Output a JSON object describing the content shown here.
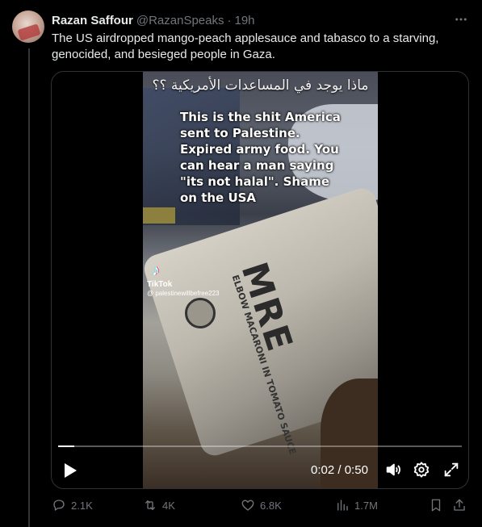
{
  "tweet": {
    "author_name": "Razan Saffour",
    "author_handle": "@RazanSpeaks",
    "separator": "·",
    "time": "19h",
    "text": "The US airdropped mango-peach applesauce and tabasco to a starving, genocided, and besieged people in Gaza."
  },
  "video": {
    "arabic_overlay": "ماذا يوجد في المساعدات الأمريكية ؟؟",
    "caption": "This is the shit America sent to Palestine. Expired army food. You can hear a man saying \"its not halal\". Shame on the USA",
    "package_text": "MRE",
    "package_subtext": "ELBOW MACARONI IN TOMATO SAUCE",
    "tiktok_label": "TikTok",
    "tiktok_user": "@ palestinewillbefree223",
    "current_time": "0:02",
    "duration": "0:50",
    "time_separator": " / ",
    "progress_fraction": 0.04
  },
  "actions": {
    "replies": "2.1K",
    "reposts": "4K",
    "likes": "6.8K",
    "views": "1.7M"
  },
  "icons": {
    "more": "more-horizontal-icon",
    "play": "play-icon",
    "volume": "volume-icon",
    "settings": "settings-icon",
    "fullscreen": "fullscreen-icon",
    "reply": "reply-icon",
    "repost": "repost-icon",
    "like": "heart-icon",
    "views": "views-icon",
    "bookmark": "bookmark-icon",
    "share": "share-icon"
  },
  "colors": {
    "background": "#000000",
    "text": "#e7e9ea",
    "muted": "#71767b",
    "border": "#2f3336"
  }
}
